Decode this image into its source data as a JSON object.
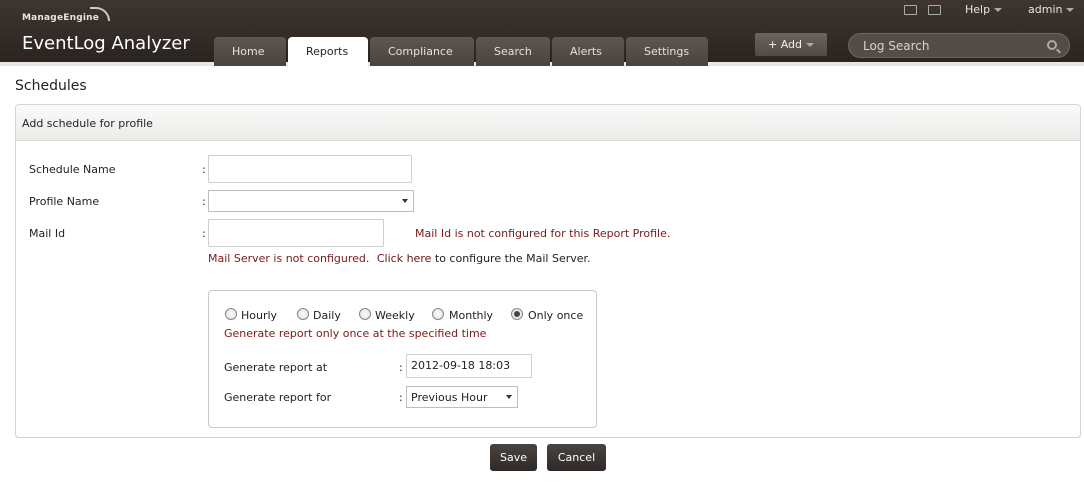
{
  "header": {
    "brand_small": "ManageEngine",
    "brand_name": "EventLog Analyzer",
    "help_label": "Help",
    "user_label": "admin",
    "add_label": "+ Add",
    "search_placeholder": "Log Search",
    "tabs": [
      {
        "label": "Home"
      },
      {
        "label": "Reports"
      },
      {
        "label": "Compliance"
      },
      {
        "label": "Search"
      },
      {
        "label": "Alerts"
      },
      {
        "label": "Settings"
      }
    ],
    "active_tab": "Reports",
    "icons": [
      "monitor-icon",
      "window-icon",
      "search-icon"
    ]
  },
  "page": {
    "title": "Schedules",
    "panel_title": "Add schedule for profile"
  },
  "form": {
    "schedule_name_label": "Schedule Name",
    "profile_name_label": "Profile Name",
    "mail_id_label": "Mail Id",
    "colon": ":",
    "schedule_name_value": "",
    "profile_name_value": "",
    "mail_id_value": "",
    "mail_id_warning": "Mail Id is not configured for this Report Profile.",
    "mail_server_warning": "Mail Server is not configured.",
    "click_here": "Click here",
    "configure_text": "to configure the Mail Server."
  },
  "schedule": {
    "options": [
      "Hourly",
      "Daily",
      "Weekly",
      "Monthly",
      "Only once"
    ],
    "selected": "Only once",
    "description": "Generate report only once at the specified time",
    "generate_at_label": "Generate report at",
    "generate_at_value": "2012-09-18 18:03",
    "generate_for_label": "Generate report for",
    "generate_for_value": "Previous Hour"
  },
  "actions": {
    "save_label": "Save",
    "cancel_label": "Cancel"
  },
  "colors": {
    "header_bg": "#2f2824",
    "warning_text": "#7a1a1a",
    "button_bg": "#3a3431"
  }
}
